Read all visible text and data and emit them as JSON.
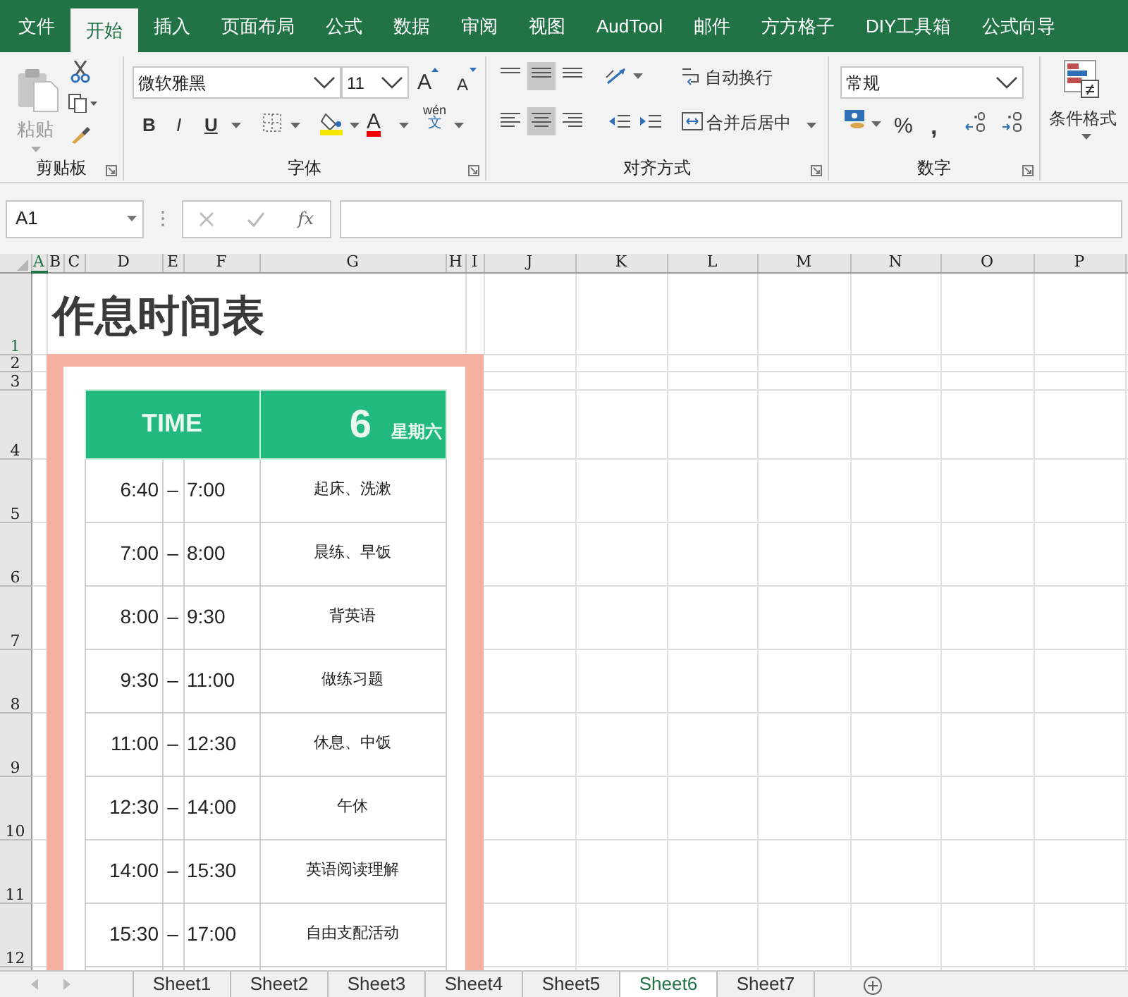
{
  "ribbon_tabs": [
    {
      "label": "文件",
      "selected": false
    },
    {
      "label": "开始",
      "selected": true
    },
    {
      "label": "插入",
      "selected": false
    },
    {
      "label": "页面布局",
      "selected": false
    },
    {
      "label": "公式",
      "selected": false
    },
    {
      "label": "数据",
      "selected": false
    },
    {
      "label": "审阅",
      "selected": false
    },
    {
      "label": "视图",
      "selected": false
    },
    {
      "label": "AudTool",
      "selected": false
    },
    {
      "label": "邮件",
      "selected": false
    },
    {
      "label": "方方格子",
      "selected": false
    },
    {
      "label": "DIY工具箱",
      "selected": false
    },
    {
      "label": "公式向导",
      "selected": false
    }
  ],
  "clipboard": {
    "paste": "粘贴",
    "group_label": "剪贴板"
  },
  "font": {
    "font_name": "微软雅黑",
    "font_size": "11",
    "grow": "A",
    "shrink": "A",
    "bold": "B",
    "italic": "I",
    "underline": "U",
    "font_color": "A",
    "phonetic_top": "wén",
    "phonetic_bottom": "文",
    "group_label": "字体"
  },
  "alignment": {
    "wrap_text": "自动换行",
    "merge_center": "合并后居中",
    "group_label": "对齐方式"
  },
  "number": {
    "format": "常规",
    "percent": "%",
    "comma": ",",
    "group_label": "数字"
  },
  "styles": {
    "conditional_format": "条件格式"
  },
  "formula_bar": {
    "name_box": "A1",
    "function": "fx"
  },
  "column_headers": [
    {
      "label": "A",
      "selected": true
    },
    {
      "label": "B",
      "selected": false
    },
    {
      "label": "C",
      "selected": false
    },
    {
      "label": "D",
      "selected": false
    },
    {
      "label": "E",
      "selected": false
    },
    {
      "label": "F",
      "selected": false
    },
    {
      "label": "G",
      "selected": false
    },
    {
      "label": "H",
      "selected": false
    },
    {
      "label": "I",
      "selected": false
    },
    {
      "label": "J",
      "selected": false
    },
    {
      "label": "K",
      "selected": false
    },
    {
      "label": "L",
      "selected": false
    },
    {
      "label": "M",
      "selected": false
    },
    {
      "label": "N",
      "selected": false
    },
    {
      "label": "O",
      "selected": false
    },
    {
      "label": "P",
      "selected": false
    }
  ],
  "row_headers": [
    {
      "label": "1",
      "selected": true
    },
    {
      "label": "2",
      "selected": false
    },
    {
      "label": "3",
      "selected": false
    },
    {
      "label": "4",
      "selected": false
    },
    {
      "label": "5",
      "selected": false
    },
    {
      "label": "6",
      "selected": false
    },
    {
      "label": "7",
      "selected": false
    },
    {
      "label": "8",
      "selected": false
    },
    {
      "label": "9",
      "selected": false
    },
    {
      "label": "10",
      "selected": false
    },
    {
      "label": "11",
      "selected": false
    },
    {
      "label": "12",
      "selected": false
    }
  ],
  "sheet": {
    "title": "作息时间表",
    "schedule": {
      "time_label": "TIME",
      "day": "6",
      "weekday": "星期六",
      "rows": [
        {
          "start": "6:40",
          "dash": "–",
          "end": "7:00",
          "activity": "起床、洗漱"
        },
        {
          "start": "7:00",
          "dash": "–",
          "end": "8:00",
          "activity": "晨练、早饭"
        },
        {
          "start": "8:00",
          "dash": "–",
          "end": "9:30",
          "activity": "背英语"
        },
        {
          "start": "9:30",
          "dash": "–",
          "end": "11:00",
          "activity": "做练习题"
        },
        {
          "start": "11:00",
          "dash": "–",
          "end": "12:30",
          "activity": "休息、中饭"
        },
        {
          "start": "12:30",
          "dash": "–",
          "end": "14:00",
          "activity": "午休"
        },
        {
          "start": "14:00",
          "dash": "–",
          "end": "15:30",
          "activity": "英语阅读理解"
        },
        {
          "start": "15:30",
          "dash": "–",
          "end": "17:00",
          "activity": "自由支配活动"
        }
      ]
    }
  },
  "sheet_tabs": [
    {
      "label": "Sheet1",
      "selected": false
    },
    {
      "label": "Sheet2",
      "selected": false
    },
    {
      "label": "Sheet3",
      "selected": false
    },
    {
      "label": "Sheet4",
      "selected": false
    },
    {
      "label": "Sheet5",
      "selected": false
    },
    {
      "label": "Sheet6",
      "selected": true
    },
    {
      "label": "Sheet7",
      "selected": false
    }
  ]
}
